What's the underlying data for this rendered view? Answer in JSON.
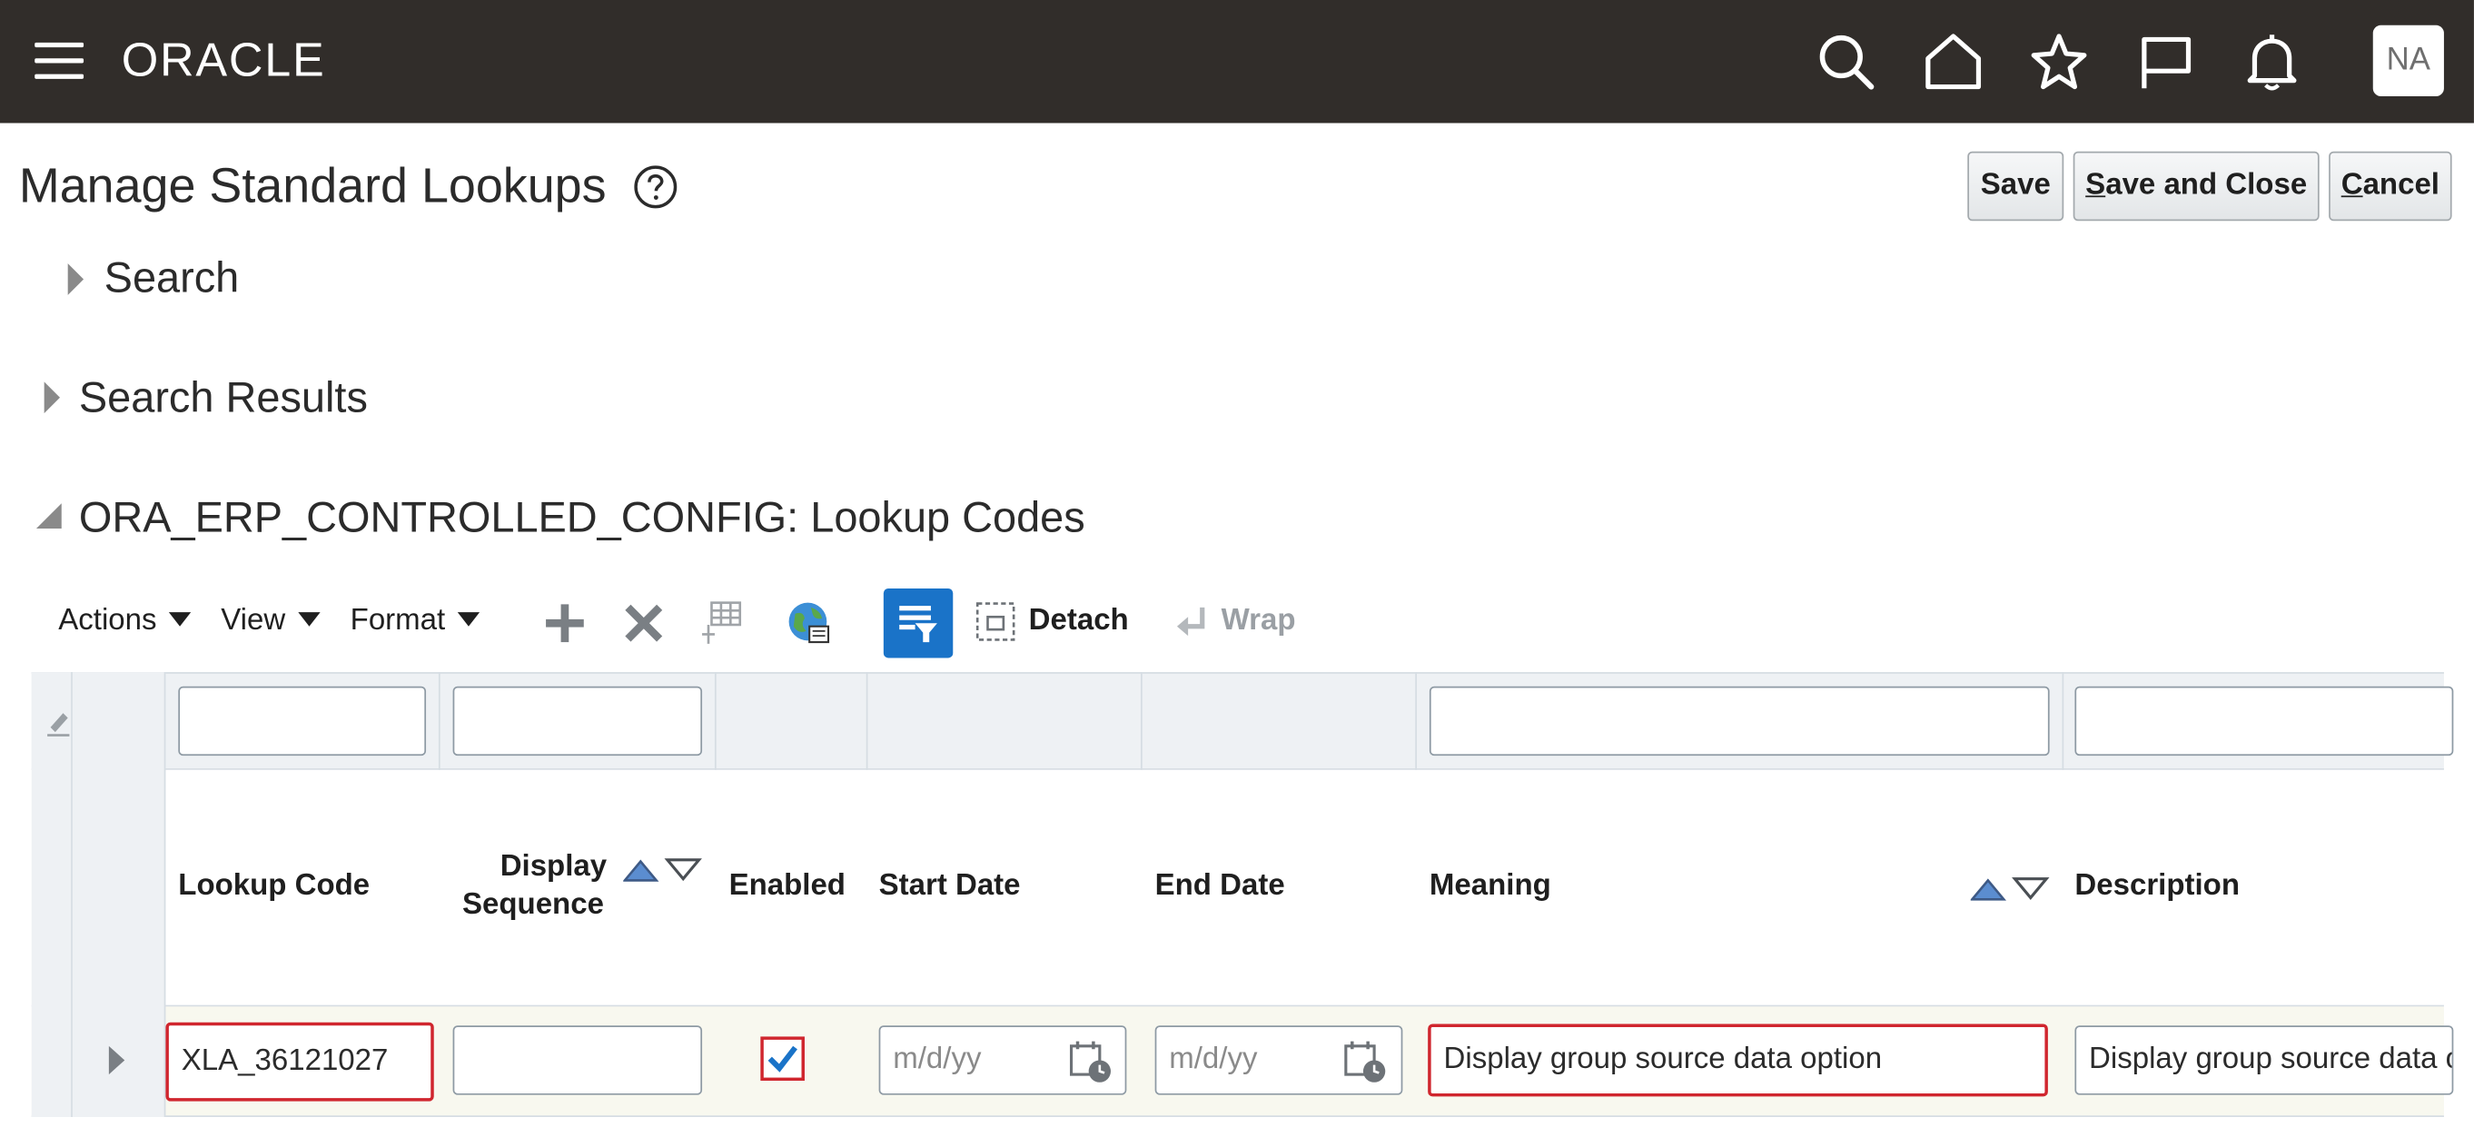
{
  "topbar": {
    "logo_text": "ORACLE",
    "icons": [
      "hamburger-menu-icon",
      "search-icon",
      "home-icon",
      "favorites-star-icon",
      "flag-icon",
      "notifications-bell-icon"
    ],
    "avatar_initials": "NA",
    "background_color": "#312d2a"
  },
  "page": {
    "title": "Manage Standard Lookups",
    "buttons": {
      "save": "Save",
      "save_close": "Save and Close",
      "cancel": "Cancel"
    }
  },
  "sections": {
    "search": "Search",
    "search_results": "Search Results",
    "lookup_codes": "ORA_ERP_CONTROLLED_CONFIG: Lookup Codes"
  },
  "toolbar": {
    "actions": "Actions",
    "view": "View",
    "format": "Format",
    "detach": "Detach",
    "wrap": "Wrap",
    "accent_color": "#1a73c8"
  },
  "table": {
    "columns": {
      "lookup_code": "Lookup Code",
      "display_sequence_1": "Display",
      "display_sequence_2": "Sequence",
      "enabled": "Enabled",
      "start_date": "Start Date",
      "end_date": "End Date",
      "meaning": "Meaning",
      "description": "Description"
    },
    "row": {
      "lookup_code": "XLA_36121027",
      "display_sequence": "",
      "enabled": true,
      "start_date_placeholder": "m/d/yy",
      "end_date_placeholder": "m/d/yy",
      "meaning": "Display group source data option",
      "description": "Display group source data option"
    },
    "error_border_color": "#d0262e"
  }
}
